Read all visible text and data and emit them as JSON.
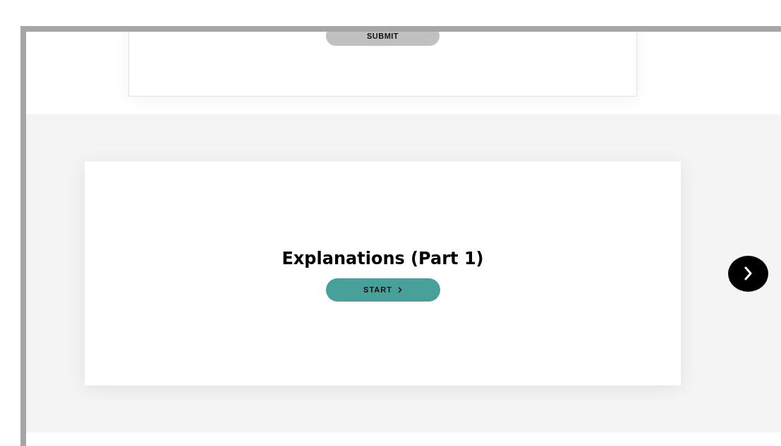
{
  "quiz_card": {
    "submit_button": "SUBMIT"
  },
  "lesson_card": {
    "title": "Explanations (Part 1)",
    "start_button": "START"
  },
  "carousel": {
    "next_button": true
  }
}
